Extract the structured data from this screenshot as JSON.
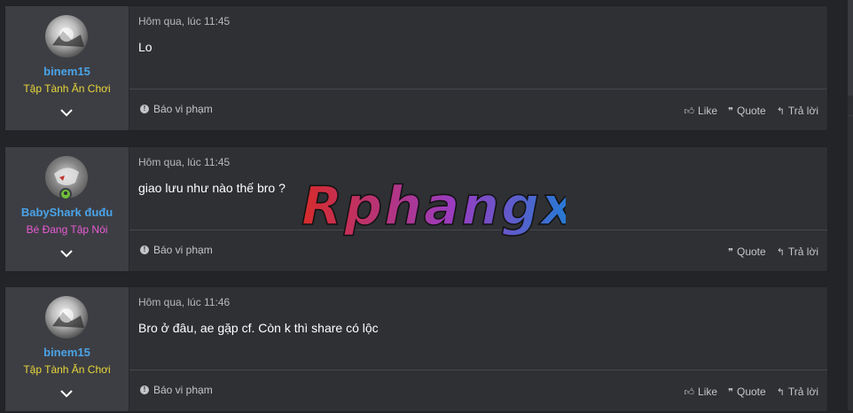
{
  "posts": [
    {
      "username": "binem15",
      "user_title": "Tập Tành Ăn Chơi",
      "user_title_color": "#e8d63a",
      "date": "Hôm qua, lúc 11:45",
      "message": "Lo",
      "show_like": true
    },
    {
      "username": "BabyShark đuđu",
      "user_title": "Bé Đang Tập Nói",
      "user_title_color": "#e85bd4",
      "date": "Hôm qua, lúc 11:45",
      "message": "giao lưu như nào thế bro ?",
      "show_like": false
    },
    {
      "username": "binem15",
      "user_title": "Tập Tành Ăn Chơi",
      "user_title_color": "#e8d63a",
      "date": "Hôm qua, lúc 11:46",
      "message": "Bro ở đâu, ae gặp cf. Còn k thì share có lộc",
      "show_like": true
    }
  ],
  "labels": {
    "report": "Báo vi phạm",
    "like": "Like",
    "quote": "Quote",
    "reply": "Trả lời"
  },
  "watermark": {
    "text": "Rphangx",
    "color_start": "#d62b2b",
    "color_end": "#1d7fd6"
  }
}
